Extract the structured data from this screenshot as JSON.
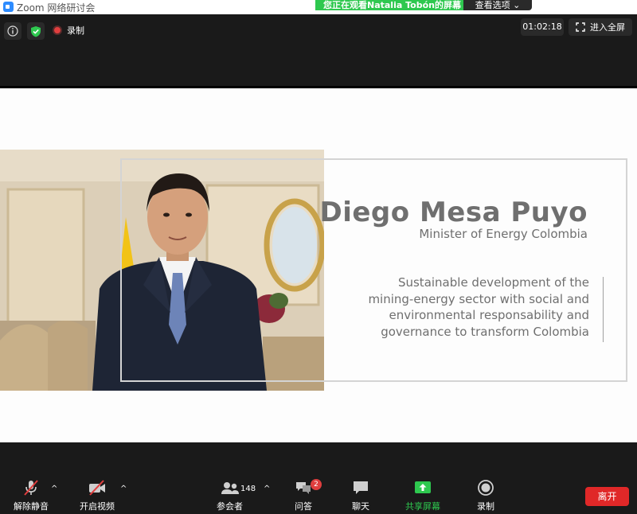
{
  "window": {
    "title": "Zoom 网络研讨会"
  },
  "share_banner": {
    "viewing_text": "您正在观看Natalia Tobón的屏幕",
    "view_options_label": "查看选项"
  },
  "topbar": {
    "recording_label": "录制",
    "timer": "01:02:18",
    "fullscreen_label": "进入全屏"
  },
  "slide": {
    "name": "Diego Mesa Puyo",
    "role": "Minister of  Energy  Colombia",
    "description_lines": [
      "Sustainable development of the",
      "mining-energy sector with social  and",
      "environmental responsability  and",
      "governance to transform  Colombia"
    ]
  },
  "toolbar": {
    "unmute_label": "解除静音",
    "start_video_label": "开启视频",
    "participants_label": "参会者",
    "participants_count": "148",
    "qa_label": "问答",
    "qa_badge": "2",
    "chat_label": "聊天",
    "share_label": "共享屏幕",
    "record_label": "录制",
    "leave_label": "离开"
  },
  "colors": {
    "share_green": "#2ec84f",
    "leave_red": "#e02828",
    "badge_red": "#e03e3e",
    "zoom_blue": "#2d8cff"
  }
}
